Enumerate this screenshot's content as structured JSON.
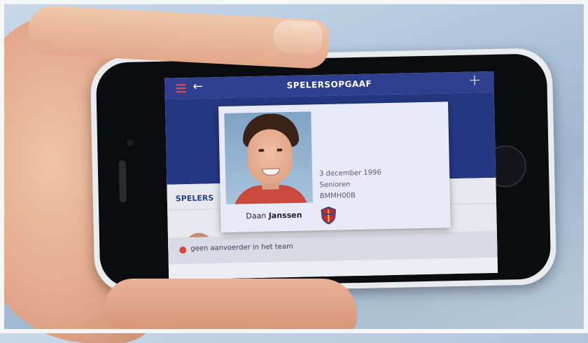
{
  "header": {
    "title": "SPELERSOPGAAF",
    "menu_icon": "hamburger-menu-icon",
    "back_icon": "arrow-left-icon",
    "add_icon": "plus-icon",
    "add_symbol": "+",
    "back_symbol": "←"
  },
  "section": {
    "label": "SPELERS"
  },
  "player_card": {
    "first_name": "Daan",
    "last_name": "Janssen",
    "birth_date": "3 december 1996",
    "category": "Senioren",
    "code": "BMMH00B",
    "club_logo_icon": "club-shield-icon"
  },
  "notice": {
    "text": "geen aanvoerder in het team",
    "icon": "error-dot-icon"
  },
  "colors": {
    "header": "#2e3f8f",
    "header_band": "#243782",
    "accent_red": "#d9443f",
    "card_bg": "#e9eaf7"
  }
}
